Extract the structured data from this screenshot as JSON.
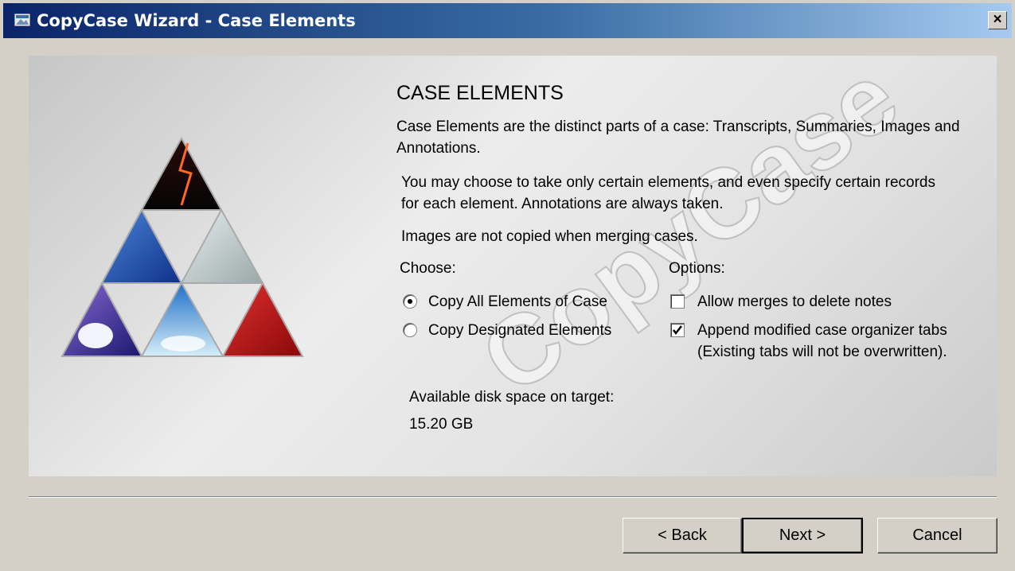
{
  "window": {
    "title": "CopyCase Wizard - Case Elements",
    "close_label": "×"
  },
  "page": {
    "heading": "CASE ELEMENTS",
    "intro": "Case Elements are the distinct parts of a case:   Transcripts, Summaries, Images and Annotations.",
    "details": "You may choose to take only certain elements, and even specify certain records for each element.  Annotations are always taken.",
    "images_note": "Images are not copied when merging cases.",
    "watermark": "CopyCase"
  },
  "choose": {
    "label": "Choose:",
    "options": [
      {
        "label": "Copy All Elements of Case",
        "selected": true
      },
      {
        "label": "Copy Designated Elements",
        "selected": false
      }
    ]
  },
  "options": {
    "label": "Options:",
    "items": [
      {
        "label": "Allow merges to delete notes",
        "checked": false
      },
      {
        "label": "Append modified case organizer tabs (Existing tabs will not be overwritten).",
        "checked": true
      }
    ]
  },
  "disk": {
    "label": "Available disk space on target:",
    "value": "15.20 GB"
  },
  "buttons": {
    "back": "< Back",
    "next": "Next >",
    "cancel": "Cancel"
  },
  "colors": {
    "titlebar_start": "#0a246a",
    "titlebar_end": "#a6caf0",
    "dialog_bg": "#d4d0c8"
  }
}
